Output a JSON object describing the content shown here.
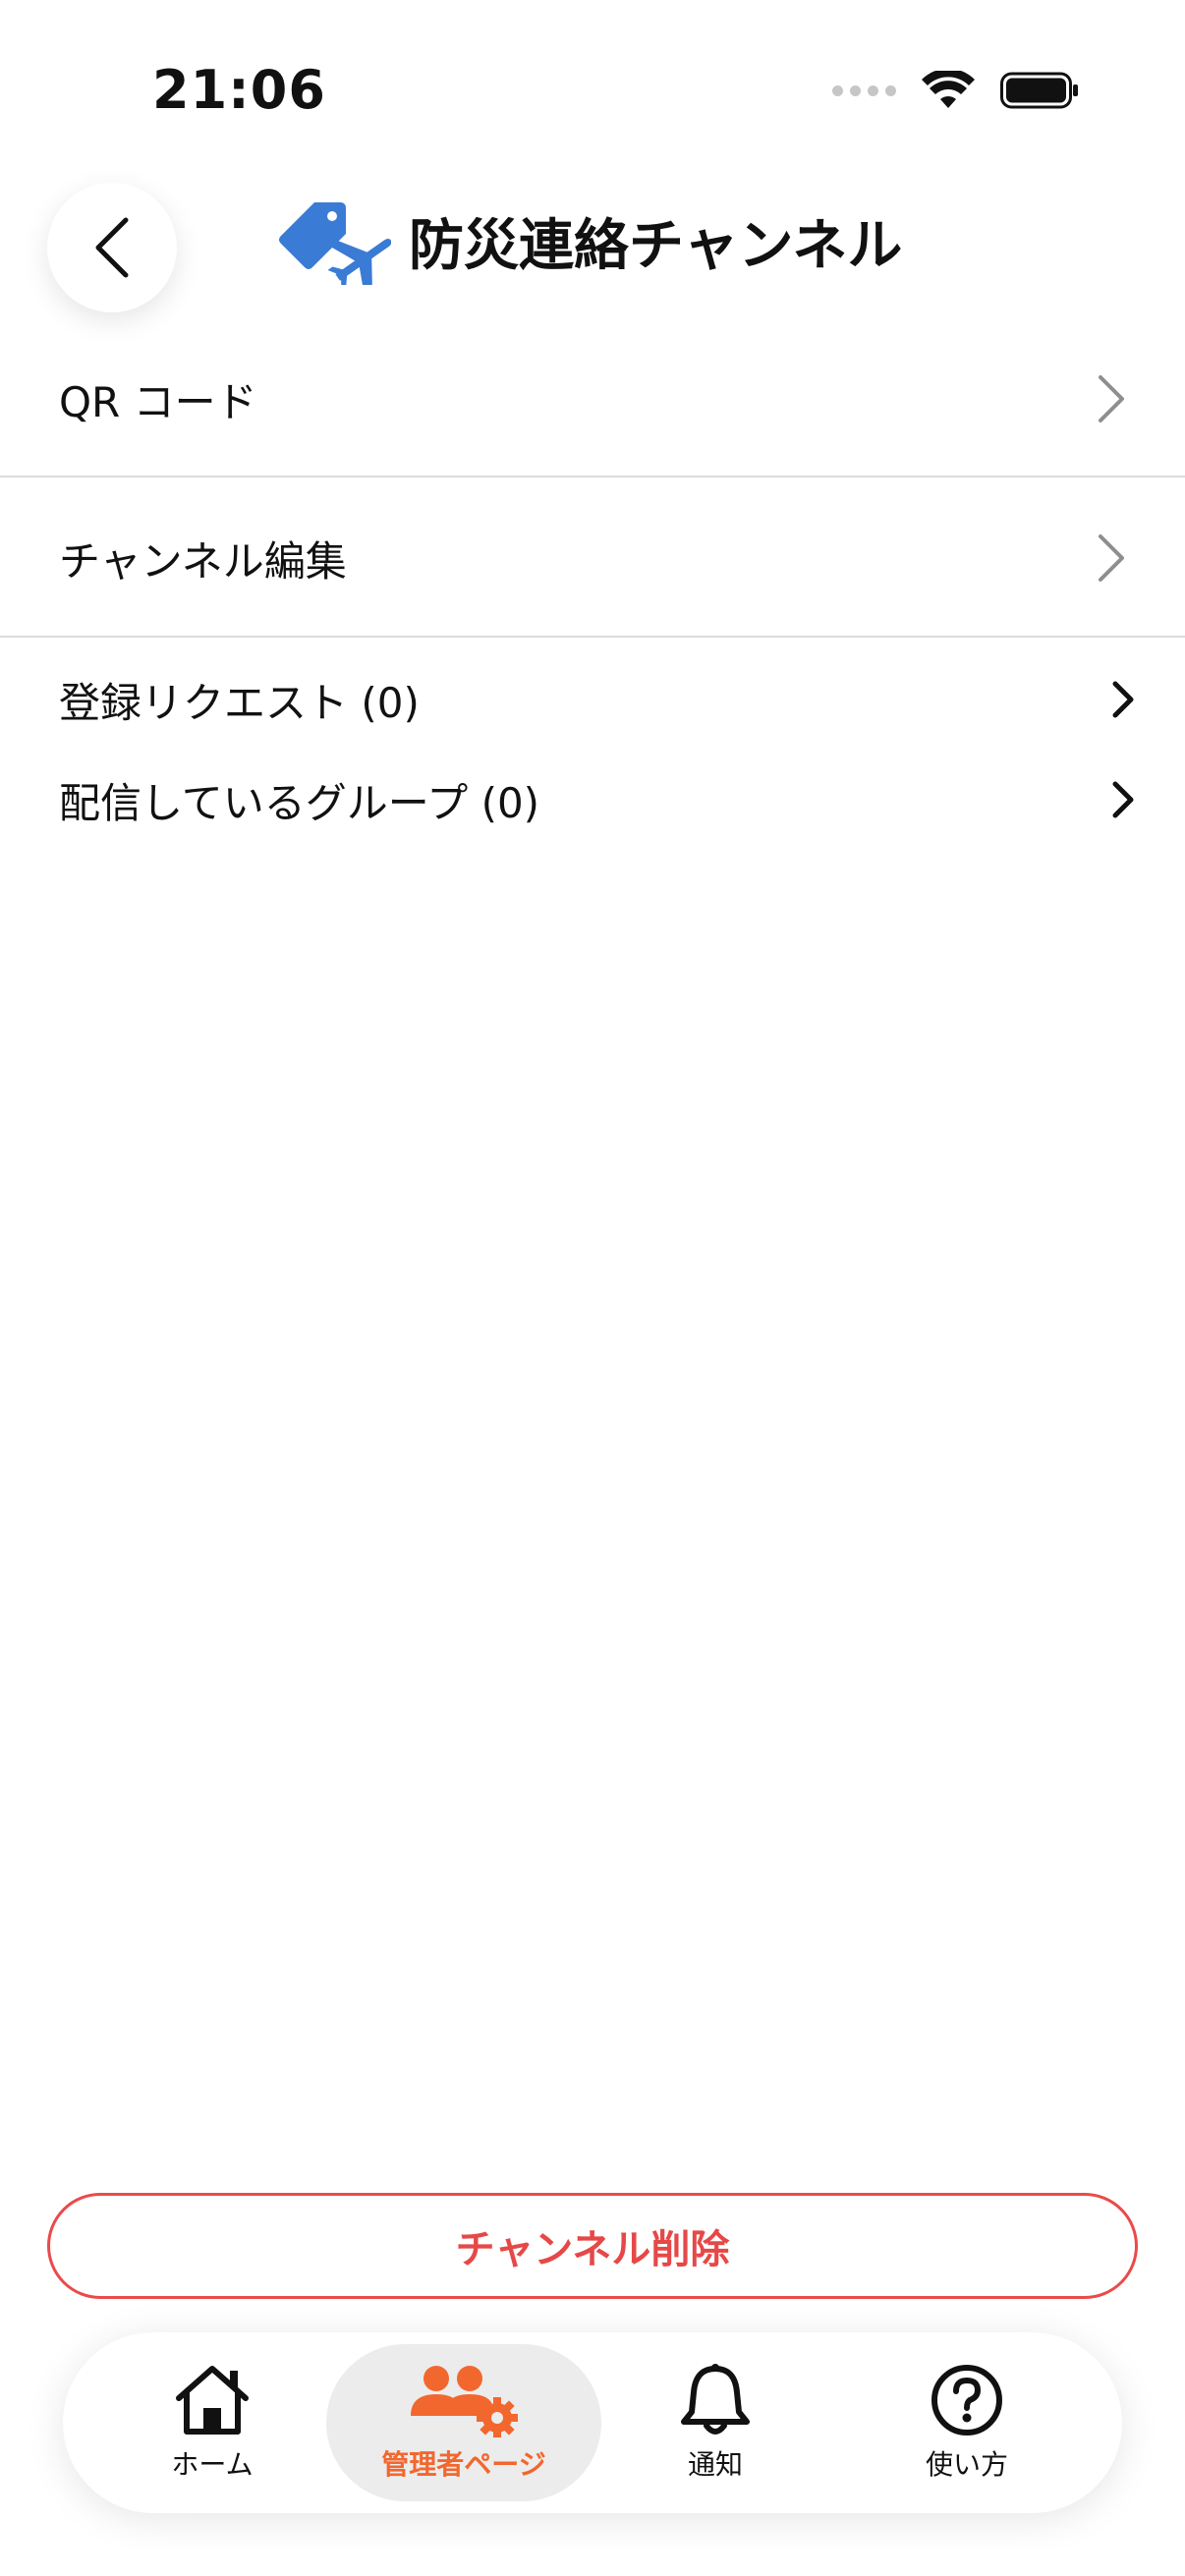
{
  "status_bar": {
    "time": "21:06"
  },
  "header": {
    "title": "防災連絡チャンネル",
    "icon": "tag-plane-icon",
    "icon_color": "#3a7bd5"
  },
  "menu": {
    "items": [
      {
        "label": "QR コード"
      },
      {
        "label": "チャンネル編集"
      },
      {
        "label": "登録リクエスト (0)"
      },
      {
        "label": "配信しているグループ (0)"
      }
    ]
  },
  "actions": {
    "delete_label": "チャンネル削除",
    "delete_color": "#e64848"
  },
  "tabbar": {
    "active_color": "#f2672e",
    "tabs": [
      {
        "label": "ホーム",
        "icon": "home-icon"
      },
      {
        "label": "管理者ページ",
        "icon": "admin-users-gear-icon",
        "active": true
      },
      {
        "label": "通知",
        "icon": "bell-icon"
      },
      {
        "label": "使い方",
        "icon": "question-circle-icon"
      }
    ]
  }
}
